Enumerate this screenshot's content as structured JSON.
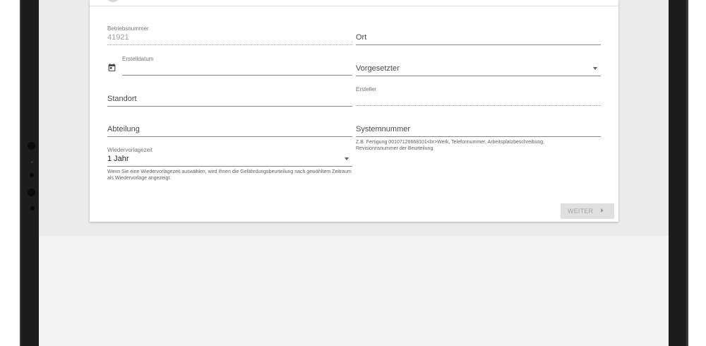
{
  "form": {
    "betriebsnummer": {
      "label": "Betriebsnummer",
      "value": "41921"
    },
    "ort": {
      "label": "Ort",
      "value": ""
    },
    "erstelldatum": {
      "label": "Erstelldatum",
      "value": ""
    },
    "vorgesetzter": {
      "label": "Vorgesetzter",
      "value": ""
    },
    "standort": {
      "label": "Standort",
      "value": ""
    },
    "ersteller": {
      "label": "Ersteller",
      "value": ""
    },
    "abteilung": {
      "label": "Abteilung",
      "value": ""
    },
    "systemnummer": {
      "label": "Systemnummer",
      "hint": "Z.B. Fertigung 00107126668101<br>Werk, Telefonnummer, Arbeitsplatzbeschreibung, Revisionnsnummer der Beurteilung"
    },
    "wiedervorlagezeit": {
      "label": "Wiedervorlagezeit",
      "value": "1 Jahr",
      "hint": "Wenn Sie eine Wiedervorlagezeit auswählen, wird Ihnen die Gefährdungsbeurteilung nach gewähltem Zeitraum als Wiedervorlage angezeigt."
    }
  },
  "actions": {
    "next_label": "WEITER"
  },
  "icons": {
    "calendar": "calendar-icon",
    "dropdown": "caret-down-icon",
    "next": "chevron-right-icon"
  },
  "colors": {
    "disabled_button": "#e0e0e0",
    "line": "#8a8a8a"
  }
}
